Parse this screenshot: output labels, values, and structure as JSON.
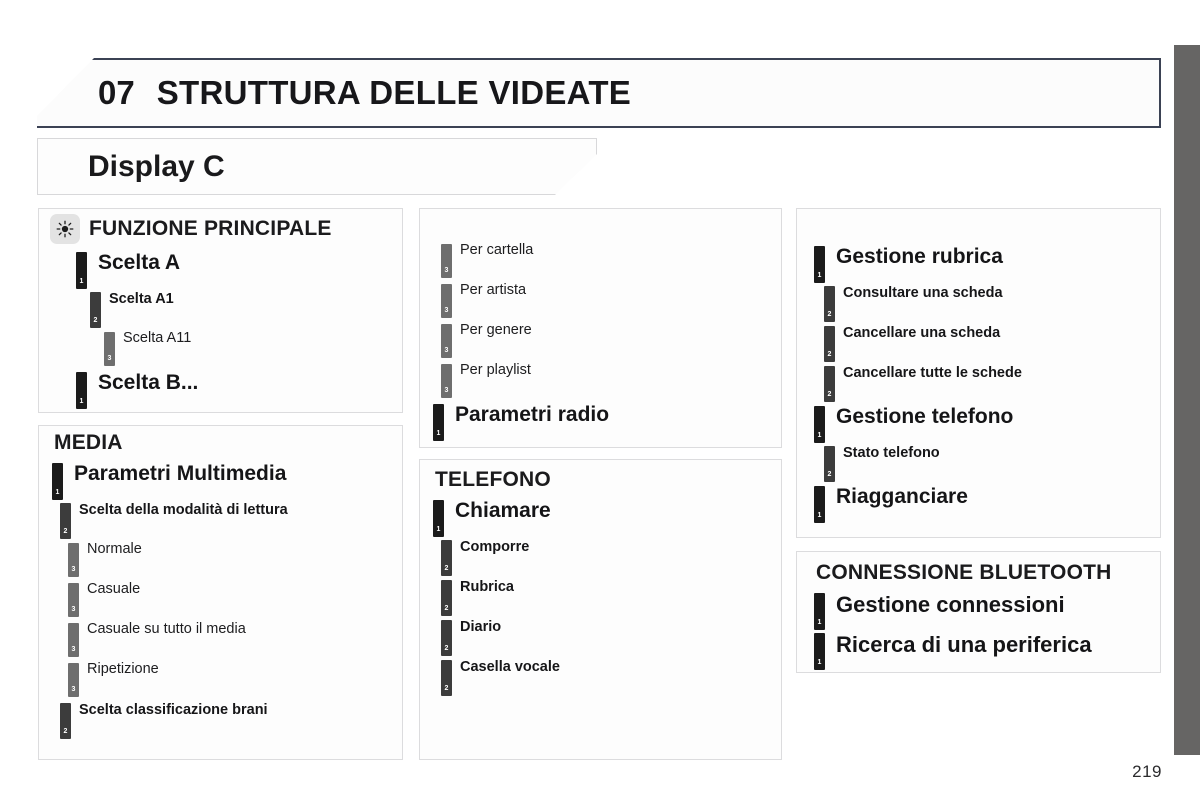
{
  "chapter": {
    "number": "07",
    "title": "STRUTTURA DELLE VIDEATE"
  },
  "banner": {
    "label": "Display C"
  },
  "page_number": "219",
  "legend_levels": {
    "lv1": "1",
    "lv2": "2",
    "lv3": "3"
  },
  "colors": {
    "level1_bar": "#1b1b1b",
    "level2_bar": "#3c3c3c",
    "level3_bar": "#6e6e6e",
    "header_border": "#3b4254",
    "page_tab": "#666564",
    "card_border": "#dcdcde"
  },
  "columns": {
    "col1": {
      "card_a": {
        "heading": "FUNZIONE PRINCIPALE",
        "icon": "sun-icon",
        "items": [
          {
            "level": 1,
            "num": "1",
            "label": "Scelta A"
          },
          {
            "level": 2,
            "num": "2",
            "label": "Scelta A1"
          },
          {
            "level": 3,
            "num": "3",
            "label": "Scelta A11"
          },
          {
            "level": 1,
            "num": "1",
            "label": "Scelta B..."
          }
        ]
      },
      "card_b": {
        "heading": "MEDIA",
        "items": [
          {
            "level": 1,
            "num": "1",
            "label": "Parametri Multimedia"
          },
          {
            "level": 2,
            "num": "2",
            "label": "Scelta della modalità di lettura"
          },
          {
            "level": 3,
            "num": "3",
            "label": "Normale"
          },
          {
            "level": 3,
            "num": "3",
            "label": "Casuale"
          },
          {
            "level": 3,
            "num": "3",
            "label": "Casuale su tutto il media"
          },
          {
            "level": 3,
            "num": "3",
            "label": "Ripetizione"
          },
          {
            "level": 2,
            "num": "2",
            "label": "Scelta classificazione brani"
          }
        ]
      }
    },
    "col2": {
      "card_a": {
        "heading": "",
        "items": [
          {
            "level": 3,
            "num": "3",
            "label": "Per cartella"
          },
          {
            "level": 3,
            "num": "3",
            "label": "Per artista"
          },
          {
            "level": 3,
            "num": "3",
            "label": "Per genere"
          },
          {
            "level": 3,
            "num": "3",
            "label": "Per playlist"
          },
          {
            "level": 1,
            "num": "1",
            "label": "Parametri radio"
          }
        ]
      },
      "card_b": {
        "heading": "TELEFONO",
        "items": [
          {
            "level": 1,
            "num": "1",
            "label": "Chiamare"
          },
          {
            "level": 2,
            "num": "2",
            "label": "Comporre"
          },
          {
            "level": 2,
            "num": "2",
            "label": "Rubrica"
          },
          {
            "level": 2,
            "num": "2",
            "label": "Diario"
          },
          {
            "level": 2,
            "num": "2",
            "label": "Casella vocale"
          }
        ]
      }
    },
    "col3": {
      "card_a": {
        "heading": "",
        "items": [
          {
            "level": 1,
            "num": "1",
            "label": "Gestione rubrica"
          },
          {
            "level": 2,
            "num": "2",
            "label": "Consultare una scheda"
          },
          {
            "level": 2,
            "num": "2",
            "label": "Cancellare una scheda"
          },
          {
            "level": 2,
            "num": "2",
            "label": "Cancellare tutte le schede"
          },
          {
            "level": 1,
            "num": "1",
            "label": "Gestione telefono"
          },
          {
            "level": 2,
            "num": "2",
            "label": "Stato telefono"
          },
          {
            "level": 1,
            "num": "1",
            "label": "Riagganciare"
          }
        ]
      },
      "card_b": {
        "heading": "CONNESSIONE BLUETOOTH",
        "items": [
          {
            "level": 1,
            "num": "1",
            "label": "Gestione connessioni"
          },
          {
            "level": 1,
            "num": "1",
            "label": "Ricerca di una periferica"
          }
        ]
      }
    }
  }
}
